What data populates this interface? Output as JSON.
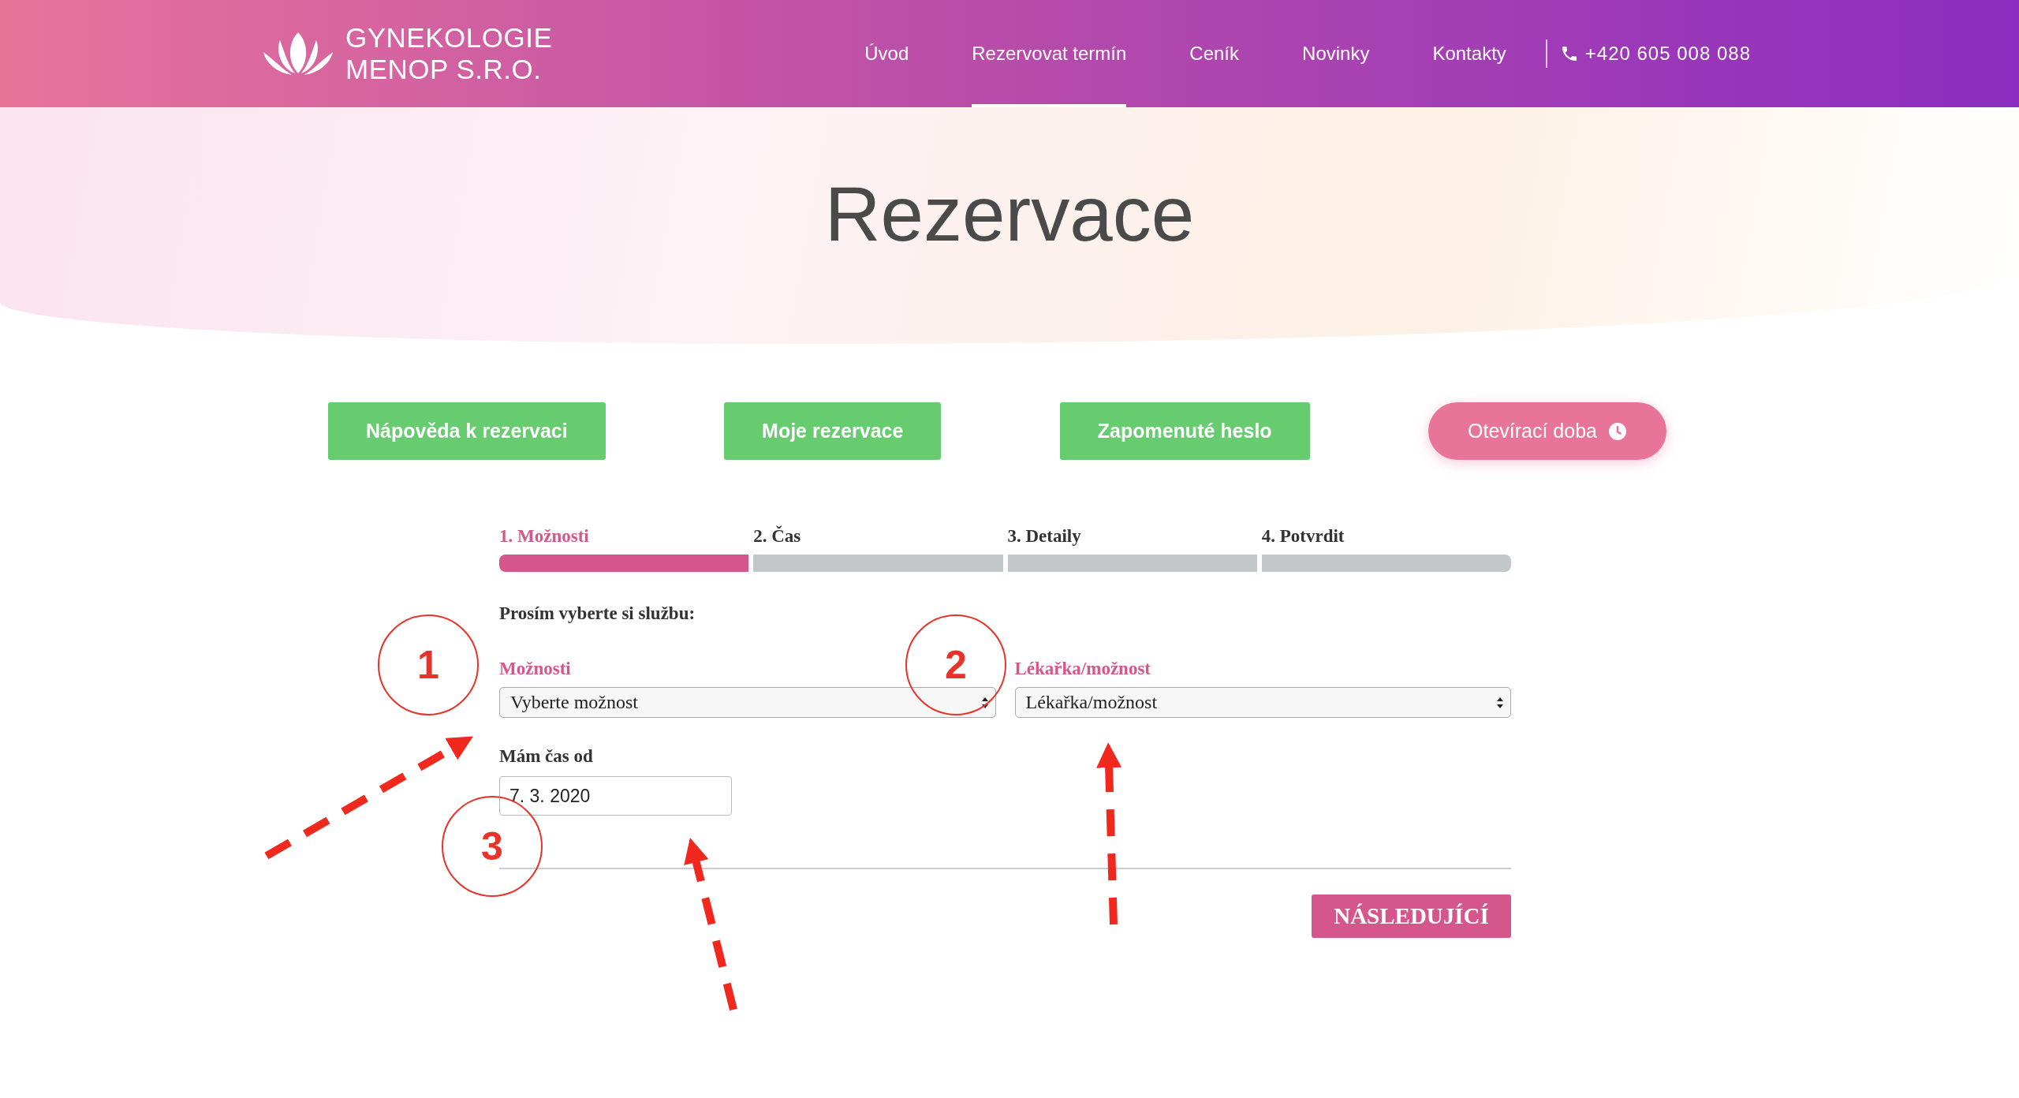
{
  "header": {
    "logo_lines": [
      "GYNEKOLOGIE",
      "MENOP S.R.O."
    ],
    "nav": [
      {
        "label": "Úvod",
        "selected": false
      },
      {
        "label": "Rezervovat termín",
        "selected": true
      },
      {
        "label": "Ceník",
        "selected": false
      },
      {
        "label": "Novinky",
        "selected": false
      },
      {
        "label": "Kontakty",
        "selected": false
      }
    ],
    "phone": "+420 605 008 088"
  },
  "page_title": "Rezervace",
  "actions": [
    {
      "label": "Nápověda k rezervaci",
      "kind": "green"
    },
    {
      "label": "Moje rezervace",
      "kind": "green"
    },
    {
      "label": "Zapomenuté heslo",
      "kind": "green"
    },
    {
      "label": "Otevírací doba",
      "kind": "pink"
    }
  ],
  "steps": [
    {
      "label": "1. Možnosti",
      "selected": true
    },
    {
      "label": "2. Čas",
      "selected": false
    },
    {
      "label": "3. Detaily",
      "selected": false
    },
    {
      "label": "4. Potvrdit",
      "selected": false
    }
  ],
  "prompt": "Prosím vyberte si službu:",
  "selects": [
    {
      "label": "Možnosti",
      "value": "Vyberte možnost"
    },
    {
      "label": "Lékařka/možnost",
      "value": "Lékařka/možnost"
    }
  ],
  "date_field": {
    "label": "Mám čas od",
    "value": "7. 3. 2020"
  },
  "next_button": "NÁSLEDUJÍCÍ",
  "annotations": [
    {
      "label": "1"
    },
    {
      "label": "2"
    },
    {
      "label": "3"
    }
  ]
}
